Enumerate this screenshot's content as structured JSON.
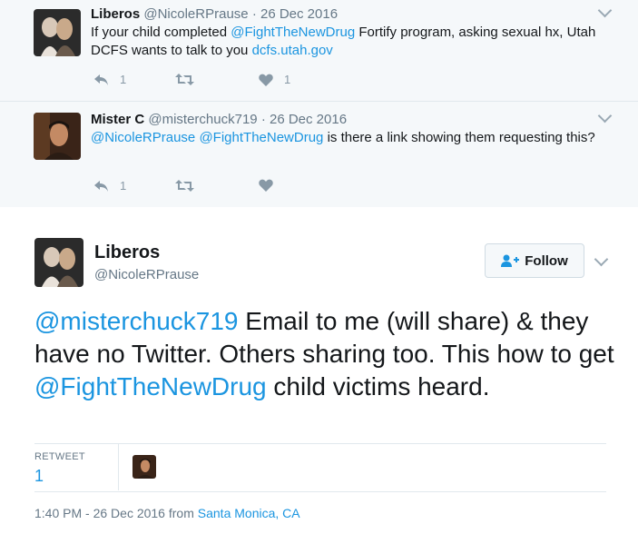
{
  "tweets": [
    {
      "name": "Liberos",
      "handle": "@NicoleRPrause",
      "date": "· 26 Dec 2016",
      "text_parts": [
        {
          "t": "If your child completed ",
          "link": false
        },
        {
          "t": "@FightTheNewDrug",
          "link": true
        },
        {
          "t": " Fortify program, asking sexual hx, Utah DCFS wants to talk to you ",
          "link": false
        },
        {
          "t": "dcfs.utah.gov",
          "link": true
        }
      ],
      "reply_count": "1",
      "retweet_count": "",
      "like_count": "1"
    },
    {
      "name": "Mister C",
      "handle": "@misterchuck719",
      "date": "· 26 Dec 2016",
      "text_parts": [
        {
          "t": "@NicoleRPrause",
          "link": true
        },
        {
          "t": " ",
          "link": false
        },
        {
          "t": "@FightTheNewDrug",
          "link": true
        },
        {
          "t": " is there a link showing them requesting this?",
          "link": false
        }
      ],
      "reply_count": "1",
      "retweet_count": "",
      "like_count": ""
    }
  ],
  "main": {
    "name": "Liberos",
    "handle": "@NicoleRPrause",
    "follow_label": "Follow",
    "text_parts": [
      {
        "t": "@misterchuck719",
        "link": true
      },
      {
        "t": " Email to me (will share) & they have no Twitter. Others sharing too. This how to get ",
        "link": false
      },
      {
        "t": "@FightTheNewDrug",
        "link": true
      },
      {
        "t": " child victims heard.",
        "link": false
      }
    ],
    "retweet_label": "RETWEET",
    "retweet_count": "1",
    "timestamp": "1:40 PM - 26 Dec 2016 from ",
    "location": "Santa Monica, CA"
  },
  "colors": {
    "link": "#1b95e0",
    "context_bg": "#f5f8fa",
    "muted": "#657786"
  },
  "icons": [
    "reply-icon",
    "retweet-icon",
    "heart-icon",
    "chevron-down-icon",
    "follow-person-icon"
  ]
}
